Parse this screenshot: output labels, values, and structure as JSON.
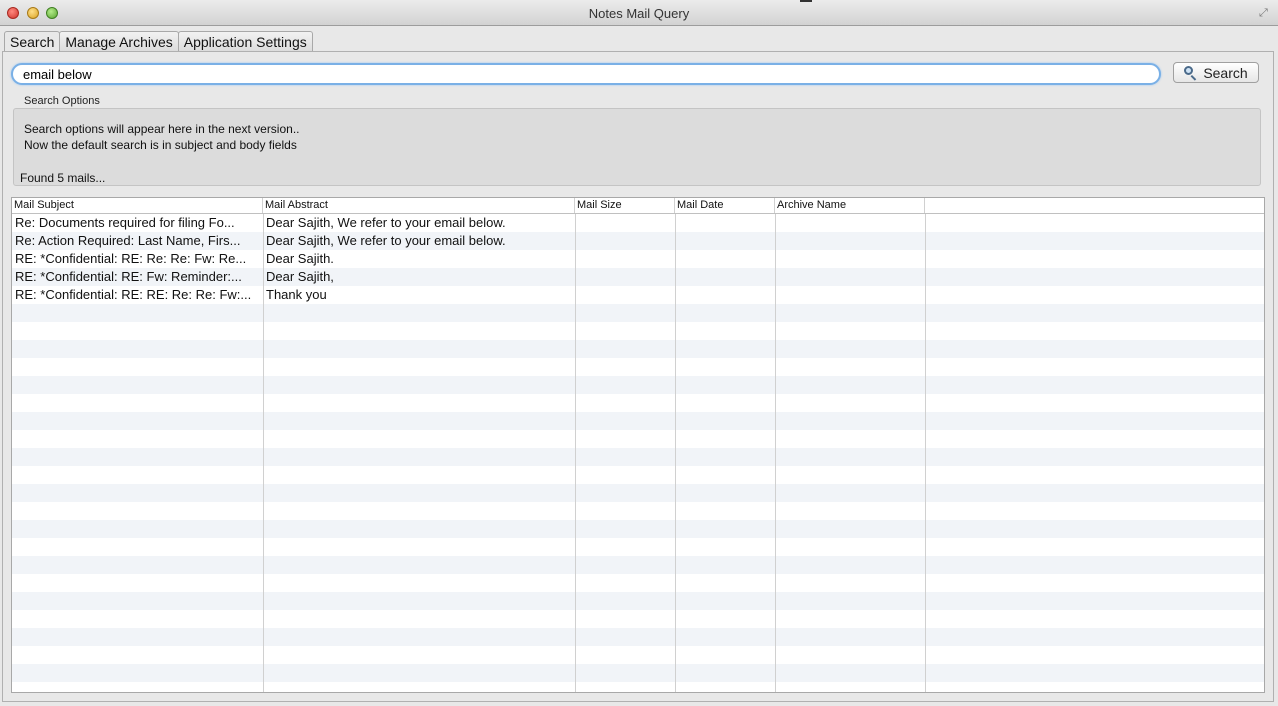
{
  "window": {
    "title": "Notes Mail Query"
  },
  "tabs": [
    {
      "label": "Search",
      "active": true
    },
    {
      "label": "Manage Archives",
      "active": false
    },
    {
      "label": "Application Settings",
      "active": false
    }
  ],
  "search": {
    "value": "email below",
    "button_label": "Search",
    "button_icon": "search-icon"
  },
  "options": {
    "label": "Search Options",
    "line1": "Search options will appear here in the next version..",
    "line2": "Now the default search is in subject and body fields",
    "status": "Found 5 mails..."
  },
  "table": {
    "columns": [
      "Mail Subject",
      "Mail Abstract",
      "Mail Size",
      "Mail Date",
      "Archive Name"
    ],
    "rows": [
      [
        "Re: Documents required for filing Fo...",
        "Dear Sajith, We refer to your email below.",
        "",
        "",
        ""
      ],
      [
        "Re: Action Required: Last Name, Firs...",
        "Dear Sajith, We refer to your email below.",
        "",
        "",
        ""
      ],
      [
        "RE: *Confidential: RE: Re: Re: Fw: Re...",
        "Dear Sajith.",
        "",
        "",
        ""
      ],
      [
        "RE: *Confidential: RE: Fw: Reminder:...",
        "Dear Sajith,",
        "",
        "",
        ""
      ],
      [
        "RE: *Confidential: RE: RE: Re: Re: Fw:...",
        "Thank you",
        "",
        "",
        ""
      ]
    ]
  },
  "colors": {
    "focus_ring": "#7ab0e6",
    "row_stripe": "#f1f4f8"
  }
}
